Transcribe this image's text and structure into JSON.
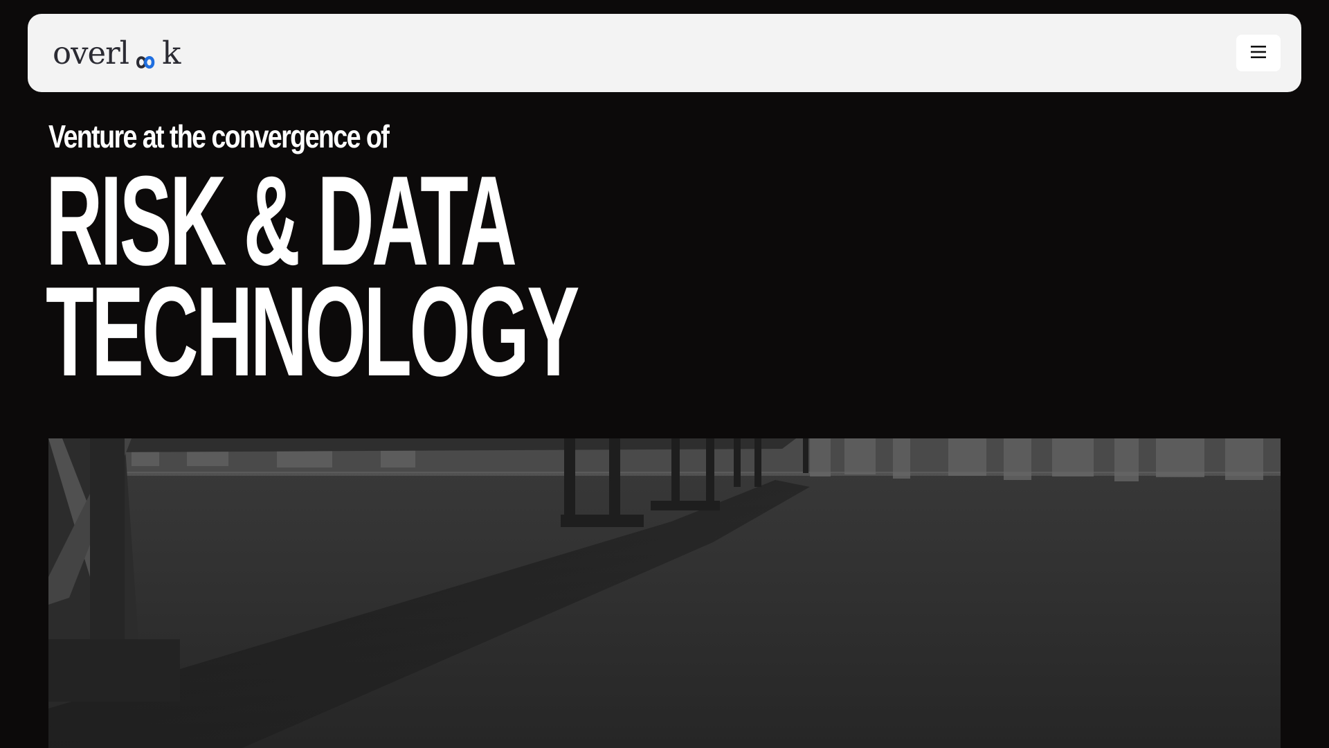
{
  "nav": {
    "logo_text_before": "overl",
    "logo_text_after": "k",
    "logo_icon": "infinity-loop-icon",
    "menu_icon": "hamburger-menu-icon",
    "accent_color": "#1f6fe0"
  },
  "hero": {
    "tagline": "Venture at the convergence of",
    "headline_line1": "RISK & DATA",
    "headline_line2": "TECHNOLOGY"
  },
  "image": {
    "subject": "grayscale photo of a suspension bridge over a bay with a city skyline"
  }
}
